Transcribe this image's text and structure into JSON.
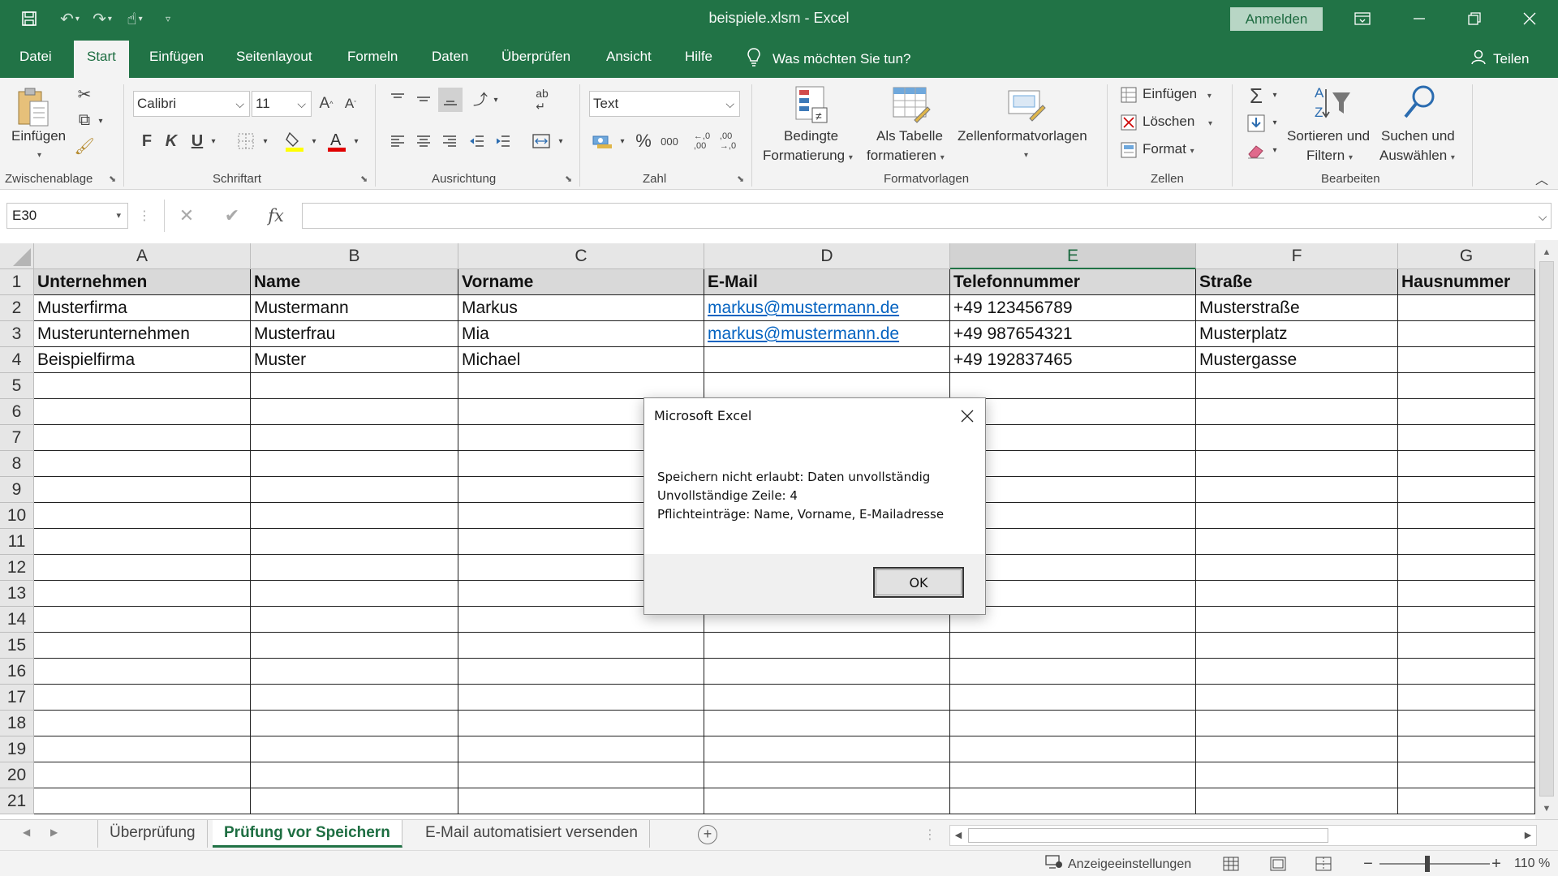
{
  "window": {
    "title": "beispiele.xlsm  -  Excel",
    "signin_label": "Anmelden"
  },
  "menu": {
    "tabs": [
      "Datei",
      "Start",
      "Einfügen",
      "Seitenlayout",
      "Formeln",
      "Daten",
      "Überprüfen",
      "Ansicht",
      "Hilfe"
    ],
    "active_tab": "Start",
    "tell_me": "Was möchten Sie tun?",
    "share": "Teilen"
  },
  "ribbon": {
    "clipboard": {
      "label": "Zwischenablage",
      "paste": "Einfügen"
    },
    "font": {
      "label": "Schriftart",
      "name": "Calibri",
      "size": "11",
      "bold": "F",
      "italic": "K",
      "underline": "U"
    },
    "alignment": {
      "label": "Ausrichtung"
    },
    "number": {
      "label": "Zahl",
      "format": "Text",
      "percent": "%",
      "thousands": "000"
    },
    "styles": {
      "label": "Formatvorlagen",
      "conditional_line1": "Bedingte",
      "conditional_line2": "Formatierung",
      "table_line1": "Als Tabelle",
      "table_line2": "formatieren",
      "cell_styles": "Zellenformatvorlagen"
    },
    "cells": {
      "label": "Zellen",
      "insert": "Einfügen",
      "delete": "Löschen",
      "format": "Format"
    },
    "editing": {
      "label": "Bearbeiten",
      "sort_line1": "Sortieren und",
      "sort_line2": "Filtern",
      "find_line1": "Suchen und",
      "find_line2": "Auswählen"
    }
  },
  "formula_bar": {
    "name_box": "E30",
    "fx": "fx",
    "value": ""
  },
  "sheet": {
    "columns": [
      "A",
      "B",
      "C",
      "D",
      "E",
      "F",
      "G"
    ],
    "selected_column": "E",
    "row_numbers": [
      "1",
      "2",
      "3",
      "4",
      "5",
      "6",
      "7",
      "8",
      "9",
      "10",
      "11",
      "12",
      "13",
      "14",
      "15",
      "16",
      "17",
      "18",
      "19",
      "20",
      "21"
    ],
    "headers": [
      "Unternehmen",
      "Name",
      "Vorname",
      "E-Mail",
      "Telefonnummer",
      "Straße",
      "Hausnummer"
    ],
    "rows": [
      [
        "Musterfirma",
        "Mustermann",
        "Markus",
        "markus@mustermann.de",
        "+49 123456789",
        "Musterstraße",
        ""
      ],
      [
        "Musterunternehmen",
        "Musterfrau",
        "Mia",
        "markus@mustermann.de",
        "+49 987654321",
        "Musterplatz",
        ""
      ],
      [
        "Beispielfirma",
        "Muster",
        "Michael",
        "",
        "+49 192837465",
        "Mustergasse",
        ""
      ]
    ]
  },
  "sheet_tabs": [
    "Überprüfung",
    "Prüfung vor Speichern",
    "E-Mail automatisiert versenden"
  ],
  "active_sheet_tab": "Prüfung vor Speichern",
  "status_bar": {
    "display_settings": "Anzeigeeinstellungen",
    "zoom": "110 %"
  },
  "dialog": {
    "title": "Microsoft Excel",
    "line1": "Speichern nicht erlaubt: Daten unvollständig",
    "line2": "Unvollständige Zeile: 4",
    "line3": "Pflichteinträge: Name, Vorname, E-Mailadresse",
    "ok": "OK"
  },
  "colors": {
    "accent": "#217346",
    "header_fill": "#d9d9d9",
    "link": "#0563c1"
  },
  "icons": [
    "save-icon",
    "undo-icon",
    "redo-icon",
    "touch-mode-icon",
    "ribbon-display-icon",
    "minimize-icon",
    "restore-icon",
    "close-icon",
    "lightbulb-icon",
    "person-icon",
    "paste-icon",
    "cut-icon",
    "copy-icon",
    "format-painter-icon",
    "sum-icon",
    "fill-icon",
    "clear-icon",
    "sort-filter-icon",
    "find-icon"
  ]
}
